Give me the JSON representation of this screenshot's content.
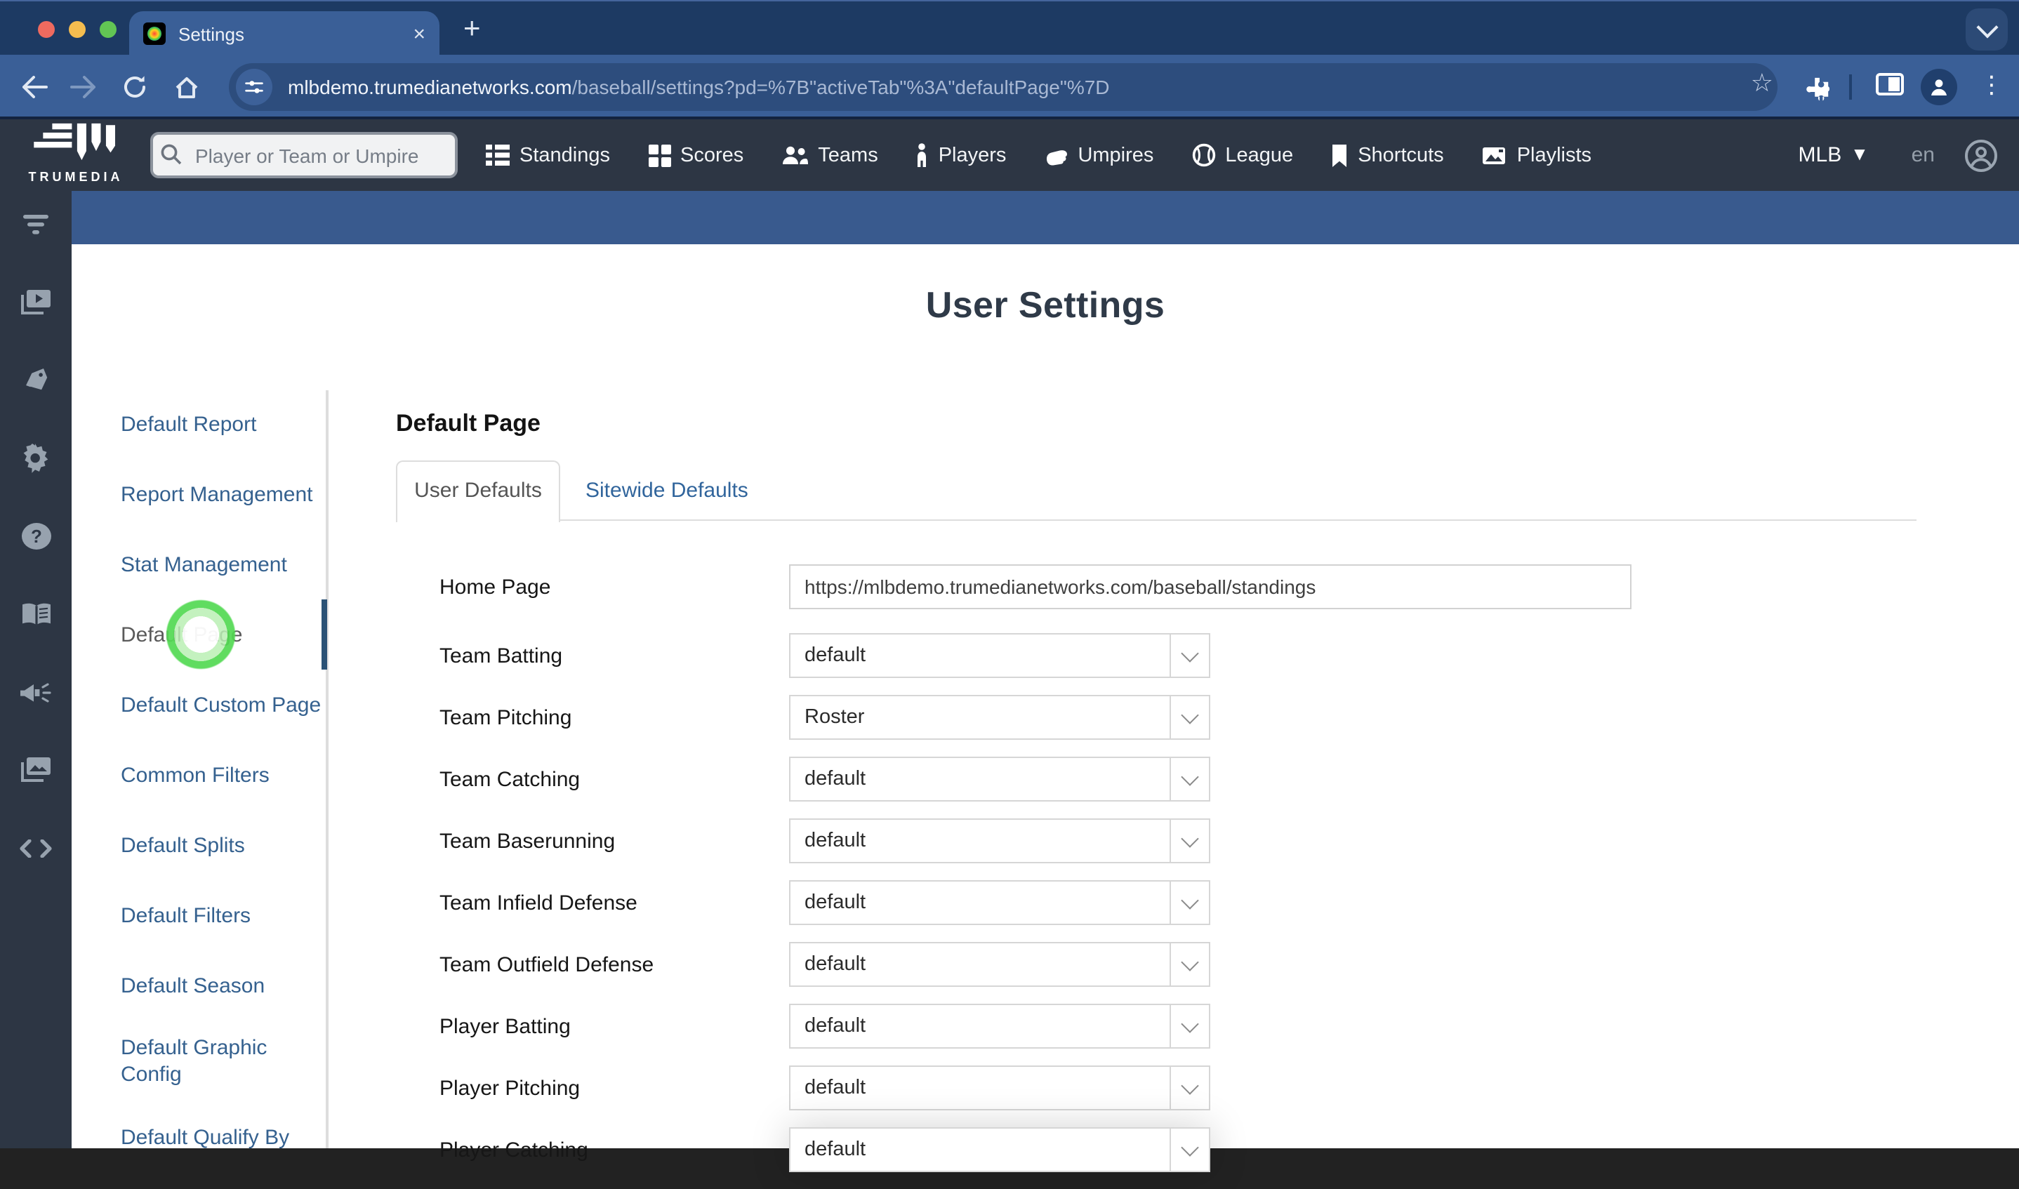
{
  "colors": {
    "chrome_dark": "#1d3a63",
    "chrome_toolbar": "#3a5f97",
    "url_pill": "#2d4d7d",
    "site_nav": "#2d3644",
    "page_header": "#395a8e",
    "sidebar_link": "#35618f",
    "active_item": "#5a5a5a",
    "active_bar": "#2b5276",
    "tab_link": "#31659c",
    "ring_green": "#52d952"
  },
  "browser": {
    "tab": {
      "title": "Settings"
    },
    "address": {
      "domain": "mlbdemo.trumedianetworks.com",
      "path": "/baseball/settings?pd=%7B\"activeTab\"%3A\"defaultPage\"%7D"
    }
  },
  "top_nav": {
    "brand": "TRUMEDIA",
    "search_placeholder": "Player or Team or Umpire",
    "items": [
      {
        "label": "Standings",
        "icon": "standings-icon"
      },
      {
        "label": "Scores",
        "icon": "scores-icon"
      },
      {
        "label": "Teams",
        "icon": "teams-icon"
      },
      {
        "label": "Players",
        "icon": "players-icon"
      },
      {
        "label": "Umpires",
        "icon": "umpires-icon"
      },
      {
        "label": "League",
        "icon": "league-icon"
      },
      {
        "label": "Shortcuts",
        "icon": "shortcuts-icon"
      },
      {
        "label": "Playlists",
        "icon": "playlists-icon"
      }
    ],
    "league": "MLB",
    "locale": "en"
  },
  "rail": {
    "icons": [
      "filter-icon",
      "video-library-icon",
      "label-tag-icon",
      "settings-gear-icon",
      "help-icon",
      "glossary-book-icon",
      "announcements-megaphone-icon",
      "image-gallery-icon",
      "embed-code-icon"
    ]
  },
  "settings_nav": {
    "active_item": "Default Page",
    "items": [
      "Default Report",
      "Report Management",
      "Stat Management",
      "Default Page",
      "Default Custom Page",
      "Common Filters",
      "Default Splits",
      "Default Filters",
      "Default Season",
      "Default Graphic Config",
      "Default Qualify By"
    ]
  },
  "main": {
    "page_title": "User Settings",
    "section_title": "Default Page",
    "tabs": [
      {
        "label": "User Defaults",
        "active": true
      },
      {
        "label": "Sitewide Defaults",
        "active": false
      }
    ],
    "form": {
      "rows": [
        {
          "label": "Home Page",
          "type": "input",
          "value": "https://mlbdemo.trumedianetworks.com/baseball/standings"
        },
        {
          "label": "Team Batting",
          "type": "select",
          "value": "default"
        },
        {
          "label": "Team Pitching",
          "type": "select",
          "value": "Roster"
        },
        {
          "label": "Team Catching",
          "type": "select",
          "value": "default"
        },
        {
          "label": "Team Baserunning",
          "type": "select",
          "value": "default"
        },
        {
          "label": "Team Infield Defense",
          "type": "select",
          "value": "default"
        },
        {
          "label": "Team Outfield Defense",
          "type": "select",
          "value": "default"
        },
        {
          "label": "Player Batting",
          "type": "select",
          "value": "default"
        },
        {
          "label": "Player Pitching",
          "type": "select",
          "value": "default"
        },
        {
          "label": "Player Catching",
          "type": "select",
          "value": "default"
        }
      ]
    }
  }
}
